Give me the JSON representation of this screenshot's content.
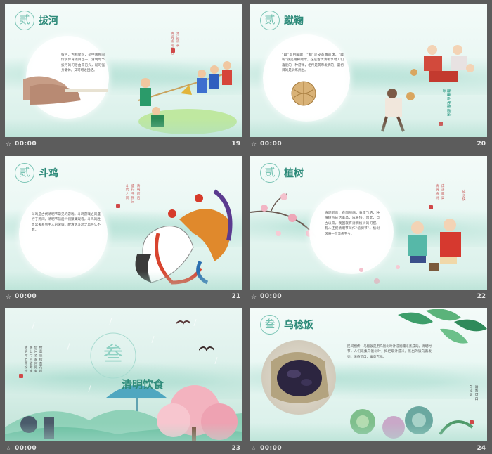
{
  "slides": [
    {
      "number": "19",
      "time": "00:00",
      "section_char": "贰",
      "title": "拔河",
      "body": "拔河，古称牵钩，是中国民间传统体育项目之一，清明时节拔河的习俗由来已久，既可强身健体，又可增进团结。",
      "side_text": [
        "清明拔河习俗",
        "源远流长"
      ]
    },
    {
      "number": "20",
      "time": "00:00",
      "section_char": "贰",
      "title": "蹴鞠",
      "body": "“蹴”即用脚踢，“鞠”是皮革做的球，“蹴鞠”就是用脚踢球，这是古代清明节时人们喜爱的一种游戏，相传是黄帝发明的，最初目的是训练武士。",
      "side_text": [
        "蹴鞠是古代的足球",
        "清明时节多举行"
      ]
    },
    {
      "number": "21",
      "time": "00:00",
      "section_char": "贰",
      "title": "斗鸡",
      "body": "斗鸡是古代清明节常见的游戏。斗鸡游戏之风盛行于民间，清明节前后人们聚集观看，斗鸡的胜负常关系到主人的荣辱，故清明斗鸡之风经久不衰。",
      "side_text": [
        "斗鸡之风",
        "盛行于民间",
        "清明前后"
      ]
    },
    {
      "number": "22",
      "time": "00:00",
      "section_char": "贰",
      "title": "植树",
      "body": "清明前后，春阳照临，春雨飞洒，种植树苗成活率高，成长快。因此，自古以来，我国就有清明植树的习惯。有人还把清明节叫作“植树节”。植树风俗一直流传至今。",
      "side_text": [
        "清明植树",
        "成活率高",
        "成长快"
      ]
    },
    {
      "number": "23",
      "time": "00:00",
      "section_char": "叁",
      "title": "清明饮食",
      "side_text": [
        "清明时节雨纷纷",
        "路上行人欲断魂",
        "借问酒家何处有",
        "牧童遥指杏花村"
      ]
    },
    {
      "number": "24",
      "time": "00:00",
      "section_char": "叁",
      "title": "乌稔饭",
      "body": "民间相传，乌稔饭是用乌饭树叶汁浸泡糯米蒸成的。清明时节，人们采集乌饭树叶，捣烂取汁浸米，蒸出的饭乌黑发亮，清香可口，寓意吉祥。",
      "side_text": [
        "乌稔饭",
        "清香可口"
      ]
    }
  ],
  "colors": {
    "accent": "#2e8b7a",
    "badge": "#6fbfae",
    "seal": "#d04848",
    "background": "#5c5c5c"
  }
}
